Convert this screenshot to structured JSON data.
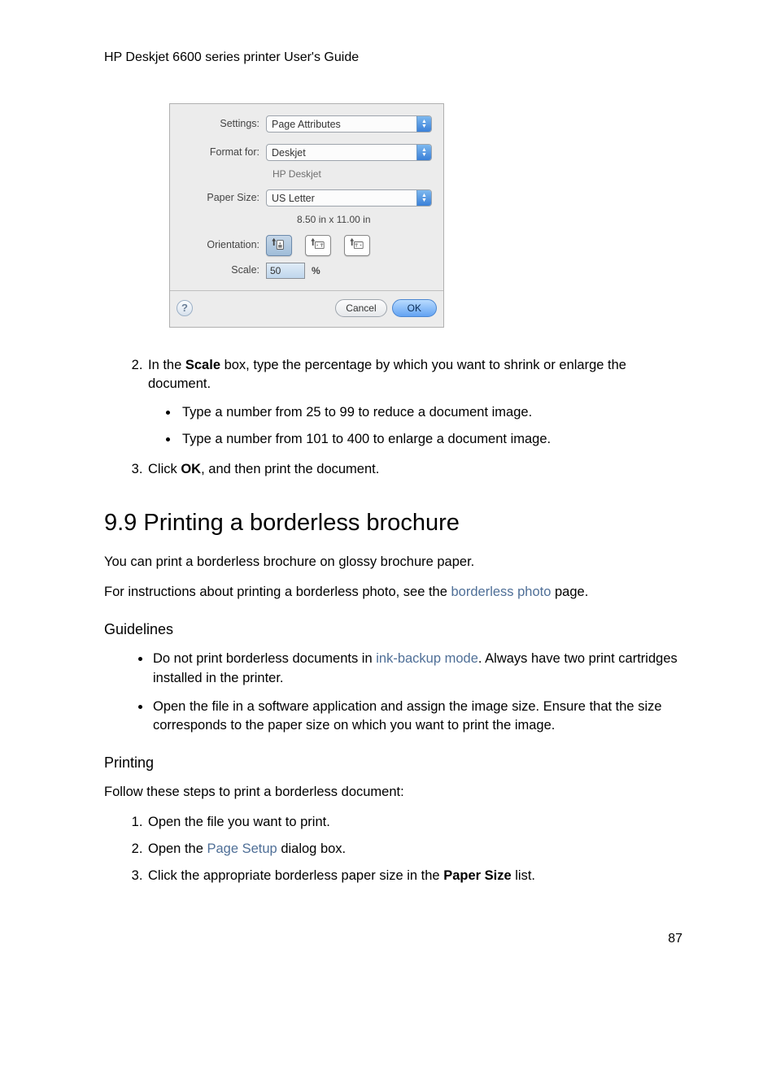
{
  "header": "HP Deskjet 6600 series printer User's Guide",
  "dialog": {
    "labels": {
      "settings": "Settings:",
      "format_for": "Format for:",
      "paper_size": "Paper Size:",
      "orientation": "Orientation:",
      "scale": "Scale:"
    },
    "values": {
      "settings": "Page Attributes",
      "format_for": "Deskjet",
      "format_for_sub": "HP Deskjet",
      "paper_size": "US Letter",
      "paper_size_sub": "8.50 in x 11.00 in",
      "scale": "50",
      "scale_suffix": "%"
    },
    "buttons": {
      "help": "?",
      "cancel": "Cancel",
      "ok": "OK"
    }
  },
  "step2_intro_a": "In the ",
  "step2_bold": "Scale",
  "step2_intro_b": " box, type the percentage by which you want to shrink or enlarge the document.",
  "step2_bullets": [
    "Type a number from 25 to 99 to reduce a document image.",
    "Type a number from 101 to 400 to enlarge a document image."
  ],
  "step3_a": "Click ",
  "step3_bold": "OK",
  "step3_b": ", and then print the document.",
  "section_title": "9.9  Printing a borderless brochure",
  "sec_p1": "You can print a borderless brochure on glossy brochure paper.",
  "sec_p2_a": "For instructions about printing a borderless photo, see the ",
  "sec_p2_link": "borderless photo",
  "sec_p2_b": " page.",
  "guidelines_heading": "Guidelines",
  "guideline1_a": "Do not print borderless documents in ",
  "guideline1_link": "ink-backup mode",
  "guideline1_b": ". Always have two print cartridges installed in the printer.",
  "guideline2": "Open the file in a software application and assign the image size. Ensure that the size corresponds to the paper size on which you want to print the image.",
  "printing_heading": "Printing",
  "printing_intro": "Follow these steps to print a borderless document:",
  "ps1": "Open the file you want to print.",
  "ps2_a": "Open the ",
  "ps2_link": "Page Setup",
  "ps2_b": " dialog box.",
  "ps3_a": "Click the appropriate borderless paper size in the ",
  "ps3_bold": "Paper Size",
  "ps3_b": " list.",
  "page_number": "87"
}
